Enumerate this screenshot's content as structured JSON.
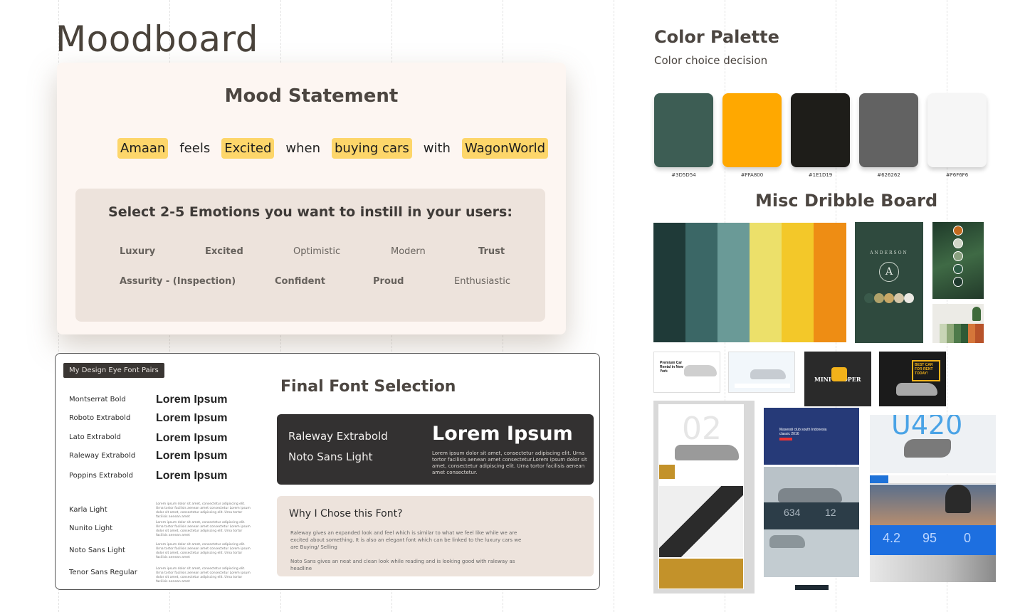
{
  "page": {
    "title": "Moodboard"
  },
  "mood": {
    "title": "Mood Statement",
    "statement": {
      "user": "Amaan",
      "feels": "feels",
      "emotion": "Excited",
      "when": "when",
      "action": "buying cars",
      "with": "with",
      "brand": "WagonWorld"
    },
    "emotions_title": "Select 2-5 Emotions you want to instill in your users:",
    "emotions": {
      "luxury": "Luxury",
      "excited": "Excited",
      "optimistic": "Optimistic",
      "modern": "Modern",
      "trust": "Trust",
      "assurity": "Assurity - (Inspection)",
      "confident": "Confident",
      "proud": "Proud",
      "enthusiastic": "Enthusiastic"
    }
  },
  "fonts": {
    "tag": "My Design Eye Font Pairs",
    "pairs": [
      {
        "name": "Montserrat Bold",
        "sample": "Lorem Ipsum"
      },
      {
        "name": "Roboto Extrabold",
        "sample": "Lorem Ipsum"
      },
      {
        "name": "Lato Extrabold",
        "sample": "Lorem Ipsum"
      },
      {
        "name": "Raleway Extrabold",
        "sample": "Lorem Ipsum"
      },
      {
        "name": "Poppins Extrabold",
        "sample": "Lorem Ipsum"
      }
    ],
    "body_pairs": [
      {
        "name": "Karla Light",
        "desc": "Lorem ipsum dolor sit amet, consectetur adipiscing elit. Urna tortor facilisis aenean amet consectetur Lorem ipsum dolor sit amet, consectetur adipiscing elit. Urna tortor facilisis aenean amet"
      },
      {
        "name": "Nunito Light",
        "desc": "Lorem ipsum dolor sit amet, consectetur adipiscing elit. Urna tortor facilisis aenean amet consectetur Lorem ipsum dolor sit amet, consectetur adipiscing elit. Urna tortor facilisis aenean amet"
      },
      {
        "name": "Noto Sans Light",
        "desc": "Lorem ipsum dolor sit amet, consectetur adipiscing elit. Urna tortor facilisis aenean amet consectetur Lorem ipsum dolor sit amet, consectetur adipiscing elit. Urna tortor facilisis aenean amet"
      },
      {
        "name": "Tenor Sans Regular",
        "desc": "Lorem ipsum dolor sit amet, consectetur adipiscing elit. Urna tortor facilisis aenean amet consectetur Lorem ipsum dolor sit amet, consectetur adipiscing elit. Urna tortor facilisis aenean amet"
      }
    ],
    "final_title": "Final Font Selection",
    "final_heading_font": "Raleway Extrabold",
    "final_body_font": "Noto Sans Light",
    "final_sample": "Lorem Ipsum",
    "final_desc": "Lorem ipsum dolor sit amet, consectetur adipiscing elit. Urna tortor facilisis aenean amet consectetur.Lorem ipsum dolor sit amet, consectetur adipiscing elit. Urna tortor facilisis aenean amet consectetur.",
    "why_title": "Why I Chose this Font?",
    "why_p1": "Raleway gives an expanded look and feel which is similar to what we feel like while we are excited about something. It is also an elegant font which can be linked to the luxury cars we are Buying/ Selling",
    "why_p2": "Noto Sans gives an neat and clean look while reading and is looking good with raleway as headline"
  },
  "palette": {
    "title": "Color Palette",
    "subtitle": "Color choice decision",
    "swatches": [
      {
        "hex": "#3D5D54",
        "label": "#3D5D54"
      },
      {
        "hex": "#FFA800",
        "label": "#FFA800"
      },
      {
        "hex": "#1E1D19",
        "label": "#1E1D19"
      },
      {
        "hex": "#626262",
        "label": "#626262"
      },
      {
        "hex": "#F6F6F6",
        "label": "#F6F6F6"
      }
    ]
  },
  "dribble": {
    "title": "Misc Dribble Board",
    "stripes": [
      "#1f3a38",
      "#3b6766",
      "#6a9a97",
      "#ece06a",
      "#f3c829",
      "#ebae1f",
      "#ee8d14"
    ],
    "anderson": {
      "brand": "ANDERSON",
      "letter": "A"
    },
    "thumb_texts": {
      "car_rental": "Premium Car Rental in New York",
      "best_car": "BEST CAR FOR RENT TODAY!",
      "mini": "MINI COOPER",
      "big_num": "02",
      "maserati": "Maserati club south Indonesia classic 2016",
      "n634": "634",
      "n12": "12",
      "u420": "U420",
      "nine": "4.2",
      "ninetyfive": "95",
      "zero": "0"
    }
  },
  "colors": {
    "highlight": "#fdd66a",
    "card_bg": "#fdf6f2",
    "panel_bg": "#ede3dc",
    "dark_panel": "#333131",
    "heading": "#4c4641"
  }
}
